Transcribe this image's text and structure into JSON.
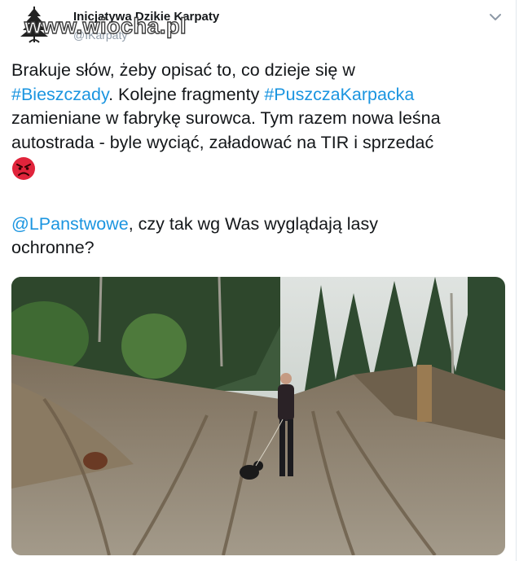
{
  "watermark": "www.wiocha.pl",
  "author": {
    "name": "Inicjatywa Dzikie Karpaty",
    "handle": "@IKarpaty",
    "avatar_icon": "fir-tree-logo-icon"
  },
  "menu_icon": "chevron-down-icon",
  "tweet": {
    "line1": "Brakuje słów, żeby opisać to, co dzieje się w",
    "hashtag1": "#Bieszczady",
    "line2_mid": ". Kolejne fragmenty ",
    "hashtag2": "#PuszczaKarpacka",
    "line3": "zamieniane w fabrykę surowca. Tym razem nowa leśna",
    "line4": "autostrada - byle wyciąć, załadować na TIR i sprzedać",
    "emoji_icon": "angry-face-emoji-icon",
    "mention": "@LPanstwowe",
    "line5_rest": ", czy tak wg Was wyglądają lasy",
    "line6": "ochronne?"
  },
  "colors": {
    "link": "#1b95e0",
    "text": "#14171a",
    "handle": "#8d99a6"
  },
  "photo": {
    "description_icon": "forest-road-photo"
  }
}
